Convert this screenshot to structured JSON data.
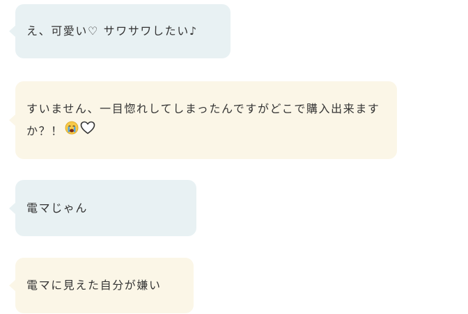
{
  "messages": [
    {
      "text": "え、可愛い♡ サワサワしたい♪",
      "style": "blue"
    },
    {
      "text": "すいません、一目惚れしてしまったんですがどこで購入出来ますか？！",
      "style": "cream",
      "emoji": [
        "crying-face-icon",
        "white-heart-icon"
      ]
    },
    {
      "text": "電マじゃん",
      "style": "blue"
    },
    {
      "text": "電マに見えた自分が嫌い",
      "style": "cream"
    }
  ],
  "colors": {
    "bubble_blue": "#e8f1f3",
    "bubble_cream": "#fbf6e7",
    "text": "#333333",
    "emoji_face": "#f7c948",
    "emoji_tears": "#4fa3e0"
  }
}
